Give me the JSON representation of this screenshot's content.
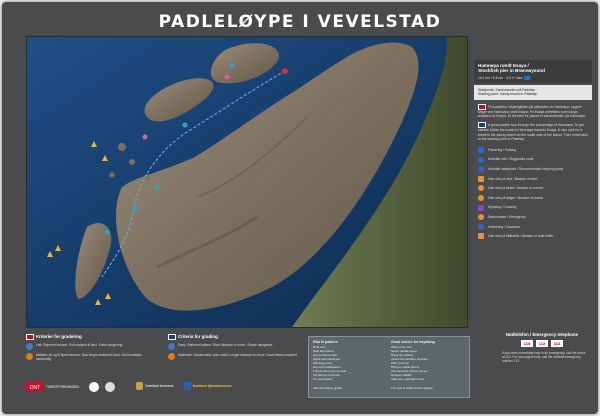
{
  "title": "PADLELØYPE I VEVELSTAD",
  "route": {
    "name_no": "Hamnøya rundt Esaya /",
    "name_en": "Stockfish pier in Brønnøysund",
    "stats": "16,1 km / 8,6 nm · 3,8 t / hour",
    "start_no": "Startpunkt: Sandstranden på Padeløp",
    "start_en": "Starting point: Sandy beach in Padeløp"
  },
  "description_no": "Fint padletur i skjærgården på yttersiden av Hamnøya. Løypen følger ved Hamnøya rundt Esaya. Pa Esaya anbefales turen langs østsiden av Esøya. Et fint sted for pause er sandstranden på Hamnøya.",
  "description_en": "A great paddle tour through the archipelago of Hamnøya. To get started, follow the coast of Hamnøya towards Esaya. A nice spot for a break is the sandy beach on the south side of the island. Then head back to the starting point in Padeløp.",
  "legend": [
    {
      "label": "Parkering / Parking",
      "color": "#2f67c6"
    },
    {
      "label": "Anbefalt rute / Suggested route",
      "color": "#2f67c6"
    },
    {
      "label": "Anbefalt rasteplass / Recommended stopping place",
      "color": "#2f67c6"
    },
    {
      "label": "Vær obs på vind / Beware of wind",
      "color": "#e6913a"
    },
    {
      "label": "Vær obs på strøm / Beware of current",
      "color": "#e6913a"
    },
    {
      "label": "Vær obs på bølger / Beware of waves",
      "color": "#e6913a"
    },
    {
      "label": "Kryssing / Crossing",
      "color": "#8d4ab0"
    },
    {
      "label": "Nødnummer / Emergency",
      "color": "#e6913a"
    },
    {
      "label": "Veiledning / Guidance",
      "color": "#2f67c6"
    },
    {
      "label": "Vær obs på båttrafikk / Beware of boat traffic",
      "color": "#e6913a"
    }
  ],
  "criteria_no": {
    "heading": "Kriterier for gradering",
    "items": [
      "Lett: Skjermet farvann. Kort avstand til land. Enkel navigering.",
      "Middels: Av og til åpent farvann. Noe lengre avstand til land. God kondisjon nødvendig."
    ]
  },
  "criteria_en": {
    "heading": "Criteria for grading",
    "items": [
      "Easy: Sheltered waters. Short distance to shore. Simple navigation.",
      "Moderate: Occasionally open water. Longer distance to shore. Good fitness required."
    ]
  },
  "logos": [
    "TURISTFORENINGEN",
    "Vevelstad kommune",
    "Nordland fylkeskommune"
  ],
  "rules": {
    "heading_no": "Råd til padlere",
    "items_no": [
      "Bruk vest",
      "Padl aldri alene",
      "Ha med tørre klær",
      "Sjekk værmeldingen",
      "Planlegg turen",
      "Ha med mobiltelefon",
      "Fortell noen hvor du skal",
      "Vis hensyn til dyreliv",
      "Ta med søppel"
    ],
    "heading_en": "Good advice for kayaking",
    "items_en": [
      "Wear a life vest",
      "Never paddle alone",
      "Bring dry clothes",
      "Check the weather forecast",
      "Plan your trip",
      "Bring a mobile phone",
      "Tell someone where you go",
      "Respect wildlife",
      "Take your garbage home"
    ],
    "note_no": "Allemannsretten gjelder.",
    "note_en": "The right of public access applies."
  },
  "emergency": {
    "heading": "Nødtelefon / Emergency telephone",
    "numbers": [
      "110",
      "112",
      "113"
    ],
    "text": "If you need immediate help in an emergency, call the police at 112. For non-urgent help, call the medical emergency number 113."
  }
}
